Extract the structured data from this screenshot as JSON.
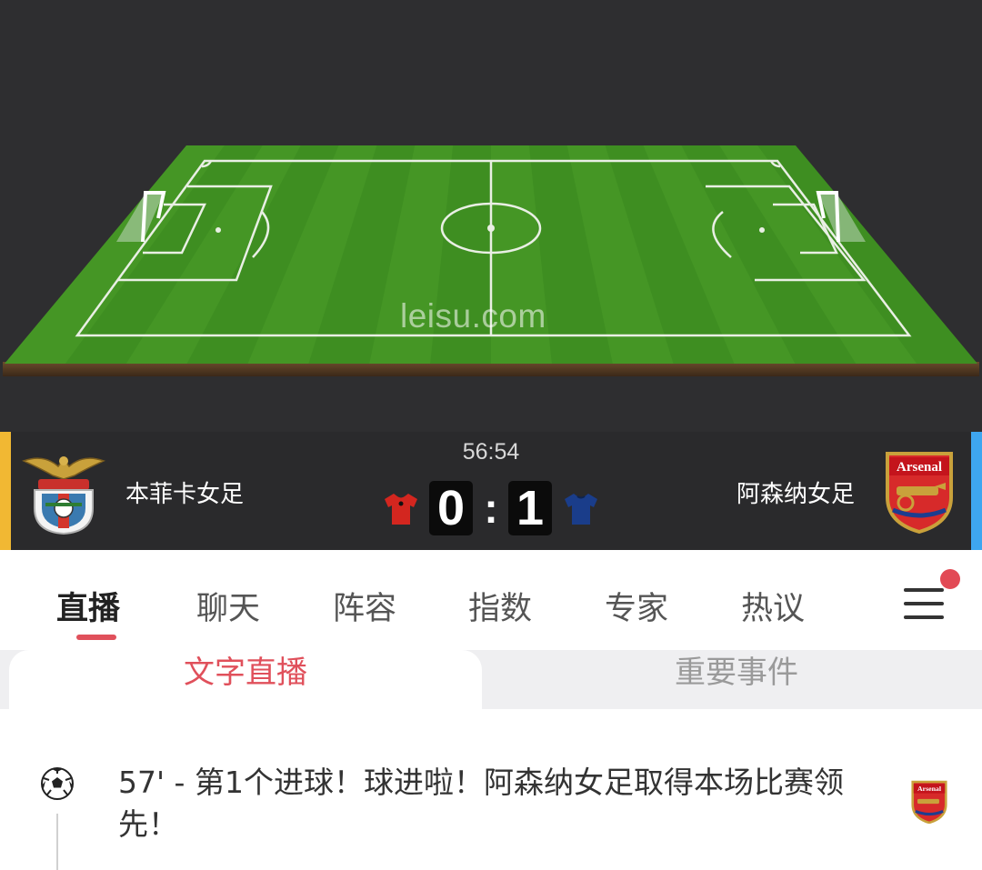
{
  "field": {
    "watermark": "leisu.com"
  },
  "match": {
    "clock": "56:54",
    "home": {
      "name": "本菲卡女足",
      "score": "0",
      "jersey_color": "#d3261f",
      "edge_color": "#f1b833"
    },
    "away": {
      "name": "阿森纳女足",
      "score": "1",
      "jersey_color": "#1a3d8a",
      "edge_color": "#3ea6f0",
      "crest_text": "Arsenal"
    },
    "separator": ":"
  },
  "tabs": {
    "items": [
      {
        "label": "直播",
        "active": true
      },
      {
        "label": "聊天"
      },
      {
        "label": "阵容"
      },
      {
        "label": "指数"
      },
      {
        "label": "专家"
      },
      {
        "label": "热议"
      }
    ],
    "menu_icon": "hamburger-menu-icon",
    "notification": true
  },
  "subtabs": {
    "active": "文字直播",
    "inactive": "重要事件"
  },
  "events": [
    {
      "icon": "soccer-ball-icon",
      "text": "57' - 第1个进球！球进啦！阿森纳女足取得本场比赛领先！",
      "team_crest": "Arsenal"
    }
  ],
  "colors": {
    "accent": "#e0505b",
    "dark_bg": "#2e2e30",
    "pitch": "#3f8f22"
  }
}
